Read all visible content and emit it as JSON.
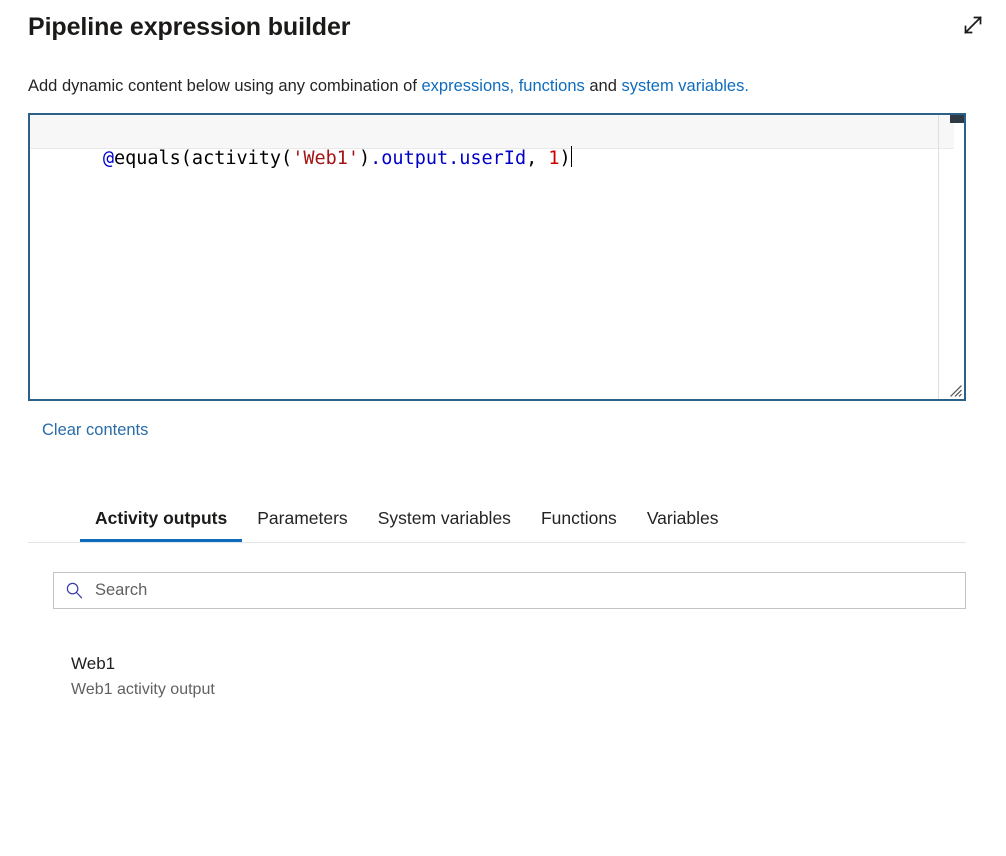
{
  "header": {
    "title": "Pipeline expression builder",
    "expand_icon": "expand-diagonal-icon"
  },
  "description": {
    "prefix": "Add dynamic content below using any combination of ",
    "link1": "expressions, functions",
    "middle": " and ",
    "link2": "system variables.",
    "link_color": "#0f6cbd"
  },
  "editor": {
    "tokens": [
      {
        "text": "@",
        "type": "at"
      },
      {
        "text": "equals(activity(",
        "type": "plain"
      },
      {
        "text": "'Web1'",
        "type": "string"
      },
      {
        "text": ")",
        "type": "plain"
      },
      {
        "text": ".output.userId",
        "type": "prop"
      },
      {
        "text": ", ",
        "type": "plain"
      },
      {
        "text": "1",
        "type": "num"
      },
      {
        "text": ")",
        "type": "plain"
      }
    ],
    "full_text": "@equals(activity('Web1').output.userId, 1)",
    "border_color": "#2b6089",
    "colors": {
      "at": "#0000d0",
      "plain": "#000000",
      "string": "#a31515",
      "property": "#0000c8",
      "number": "#cc0000"
    }
  },
  "clear_contents": {
    "label": "Clear contents"
  },
  "tabs": {
    "items": [
      {
        "label": "Activity outputs",
        "active": true
      },
      {
        "label": "Parameters",
        "active": false
      },
      {
        "label": "System variables",
        "active": false
      },
      {
        "label": "Functions",
        "active": false
      },
      {
        "label": "Variables",
        "active": false
      }
    ],
    "active_underline_color": "#0f6cbd"
  },
  "search": {
    "placeholder": "Search",
    "value": "",
    "icon": "search-icon"
  },
  "results": [
    {
      "title": "Web1",
      "subtitle": "Web1 activity output"
    }
  ]
}
